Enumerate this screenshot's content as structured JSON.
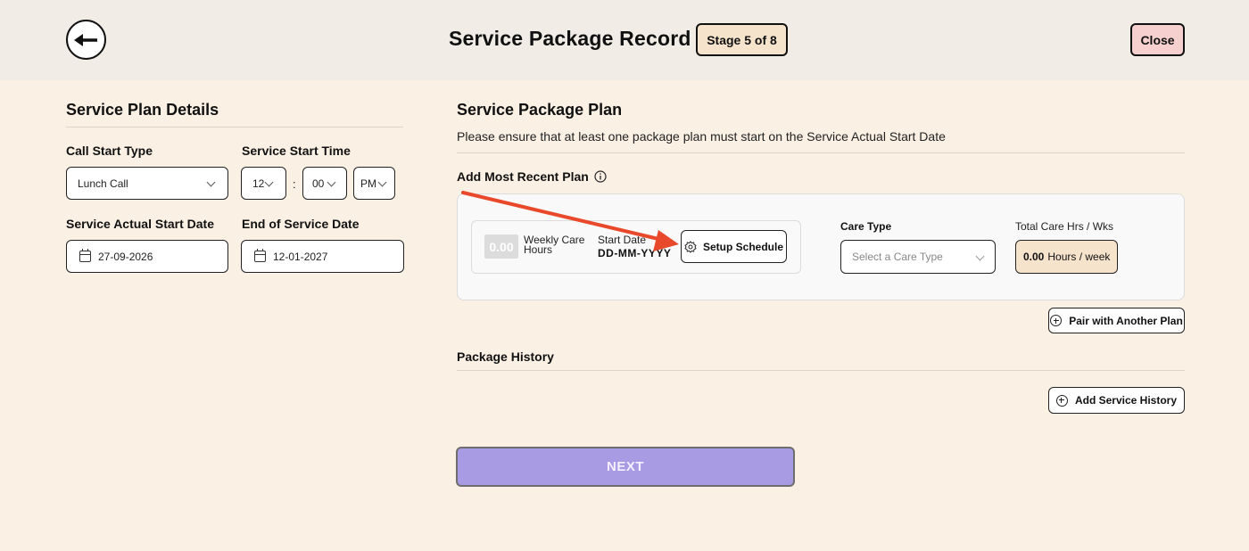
{
  "header": {
    "title": "Service Package Record",
    "stage": "Stage 5 of 8",
    "close_label": "Close"
  },
  "left": {
    "section_title": "Service Plan Details",
    "call_start_type": {
      "label": "Call Start Type",
      "value": "Lunch Call"
    },
    "service_start_time": {
      "label": "Service Start Time",
      "hour": "12",
      "separator": ":",
      "minute": "00",
      "ampm": "PM"
    },
    "actual_start": {
      "label": "Service Actual Start Date",
      "value": "27-09-2026"
    },
    "end_date": {
      "label": "End of Service Date",
      "value": "12-01-2027"
    }
  },
  "right": {
    "section_title": "Service Package Plan",
    "description": "Please ensure that at least one package plan must start on the Service Actual Start Date",
    "add_plan_label": "Add Most Recent Plan",
    "plan": {
      "hours_value": "0.00",
      "weekly_label": "Weekly Care Hours",
      "start_date_label": "Start Date",
      "start_date_value": "DD-MM-YYYY",
      "setup_label": "Setup Schedule",
      "care_type_label": "Care Type",
      "care_type_placeholder": "Select a Care Type",
      "total_label": "Total Care Hrs / Wks",
      "total_value": "0.00",
      "total_unit": "Hours / week"
    },
    "pair_label": "Pair with Another Plan",
    "history_title": "Package History",
    "add_history_label": "Add Service History",
    "next_label": "NEXT"
  },
  "colors": {
    "page_bg": "#fbf0e4",
    "header_bg": "#f1ece5",
    "next_button": "#a89be3",
    "annotation_arrow": "#e8492a"
  }
}
